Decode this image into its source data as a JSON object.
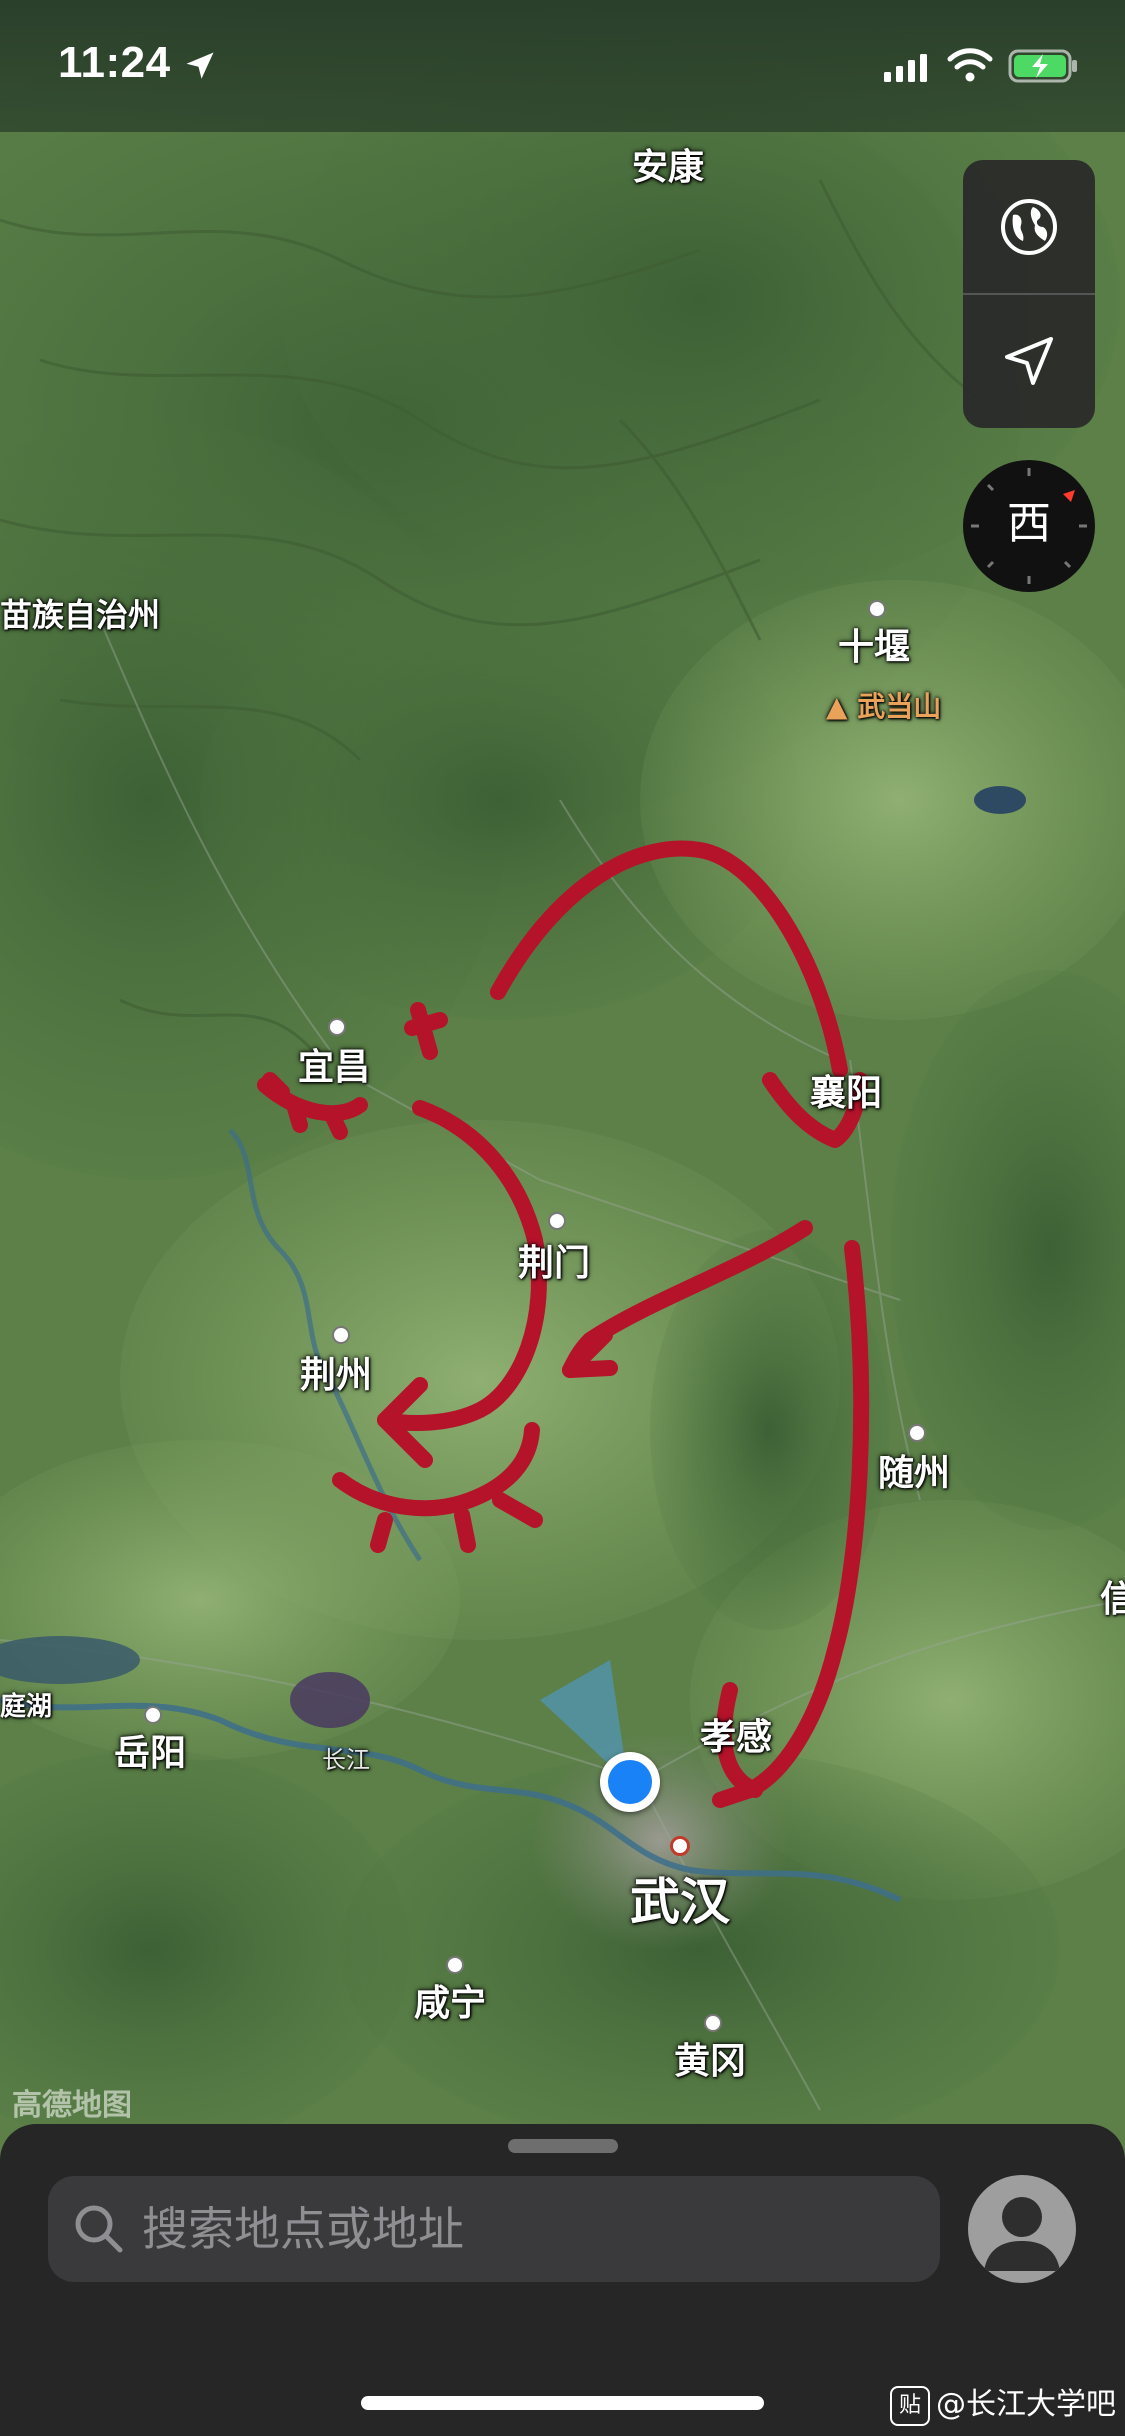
{
  "status_bar": {
    "time": "11:24"
  },
  "map": {
    "provider_logo": "高德地图",
    "colors": {
      "route_arrow": "#b5132a",
      "location_blue": "#1a82f7",
      "river_blue": "#3d6e8c"
    },
    "labels": {
      "ankang": "安康",
      "shiyan": "十堰",
      "wudangshan": "武当山",
      "autonomous": "苗族自治州",
      "yichang": "宜昌",
      "xiangyang": "襄阳",
      "jingmen": "荆门",
      "jingzhou": "荆州",
      "suizhou": "随州",
      "yueyang": "岳阳",
      "changjiang": "长江",
      "xiaogan": "孝感",
      "wuhan": "武汉",
      "xianning": "咸宁",
      "huanggang": "黄冈",
      "dongting": "庭湖",
      "xin": "信"
    }
  },
  "controls": {
    "map_mode_icon": "globe-icon",
    "locate_icon": "location-arrow-icon",
    "compass_heading": "西"
  },
  "search": {
    "placeholder": "搜索地点或地址"
  },
  "watermark": {
    "badge": "贴",
    "text": "@长江大学吧"
  }
}
